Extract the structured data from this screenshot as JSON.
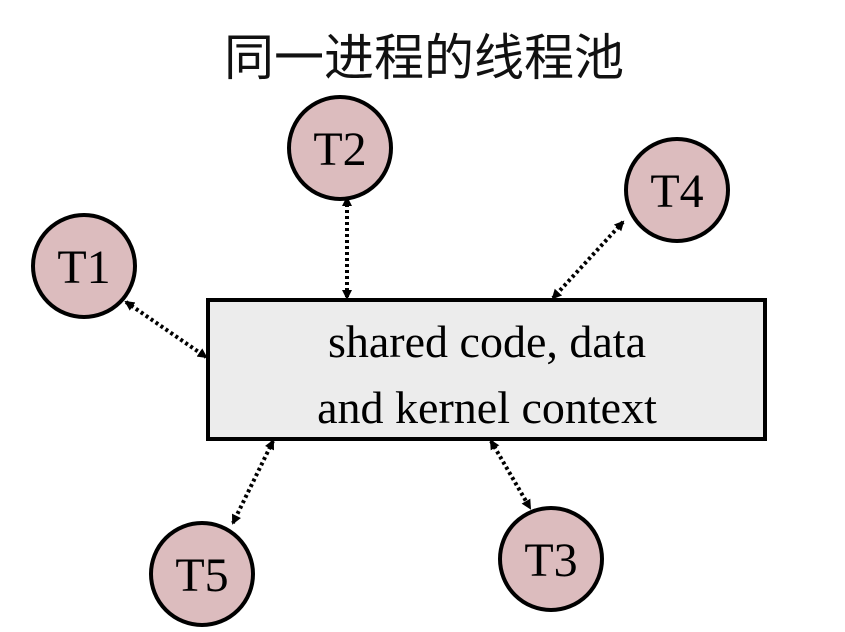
{
  "title": "同一进程的线程池",
  "center": {
    "line1": "shared code, data",
    "line2": "and kernel context"
  },
  "threads": [
    {
      "id": "t1",
      "label": "T1"
    },
    {
      "id": "t2",
      "label": "T2"
    },
    {
      "id": "t3",
      "label": "T3"
    },
    {
      "id": "t4",
      "label": "T4"
    },
    {
      "id": "t5",
      "label": "T5"
    }
  ],
  "colors": {
    "thread_fill": "#dcbcbe",
    "box_fill": "#ececec",
    "stroke": "#000000"
  }
}
